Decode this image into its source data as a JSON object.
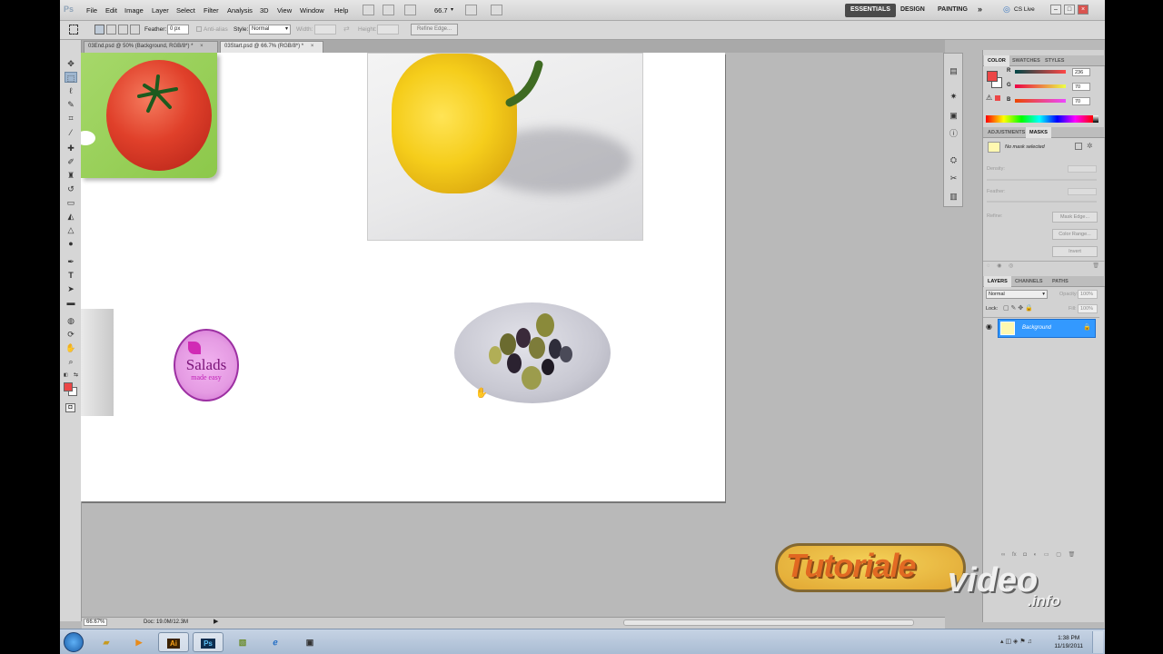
{
  "menubar": {
    "app_logo": "Ps",
    "items": [
      "File",
      "Edit",
      "Image",
      "Layer",
      "Select",
      "Filter",
      "Analysis",
      "3D",
      "View",
      "Window",
      "Help"
    ],
    "zoom": "66.7",
    "workspaces": [
      "ESSENTIALS",
      "DESIGN",
      "PAINTING"
    ],
    "more": "»",
    "cs_live": "CS Live"
  },
  "options": {
    "feather_label": "Feather:",
    "feather_value": "0 px",
    "antialias": "Anti-alias",
    "style_label": "Style:",
    "style_value": "Normal",
    "width_label": "Width:",
    "height_label": "Height:",
    "refine_edge": "Refine Edge..."
  },
  "tabs": [
    {
      "label": "03End.psd @ 50% (Background, RGB/8*) *",
      "close": "×"
    },
    {
      "label": "03Start.psd @ 66.7% (RGB/8*) *",
      "close": "×"
    }
  ],
  "canvas": {
    "logo_main": "Salads",
    "logo_sub": "made easy"
  },
  "status": {
    "zoom": "66.67%",
    "doc": "Doc: 19.0M/12.3M"
  },
  "color_panel": {
    "tabs": [
      "COLOR",
      "SWATCHES",
      "STYLES"
    ],
    "r_label": "R",
    "g_label": "G",
    "b_label": "B",
    "r_value": "236",
    "g_value": "70",
    "b_value": "70",
    "foreground": "#ec4646"
  },
  "masks_panel": {
    "tabs": [
      "ADJUSTMENTS",
      "MASKS"
    ],
    "no_mask": "No mask selected",
    "density": "Density:",
    "feather": "Feather:",
    "refine": "Refine:",
    "mask_edge": "Mask Edge...",
    "color_range": "Color Range...",
    "invert": "Invert"
  },
  "layers_panel": {
    "tabs": [
      "LAYERS",
      "CHANNELS",
      "PATHS"
    ],
    "blend_mode": "Normal",
    "opacity_label": "Opacity:",
    "opacity_value": "100%",
    "lock_label": "Lock:",
    "fill_label": "Fill:",
    "fill_value": "100%",
    "layer_name": "Background"
  },
  "taskbar": {
    "apps": [
      "Ai",
      "Ps"
    ],
    "time": "1:38 PM",
    "date": "11/19/2011"
  },
  "watermark": {
    "part1": "Tutoriale",
    "part2": "video",
    "part3": ".info"
  }
}
